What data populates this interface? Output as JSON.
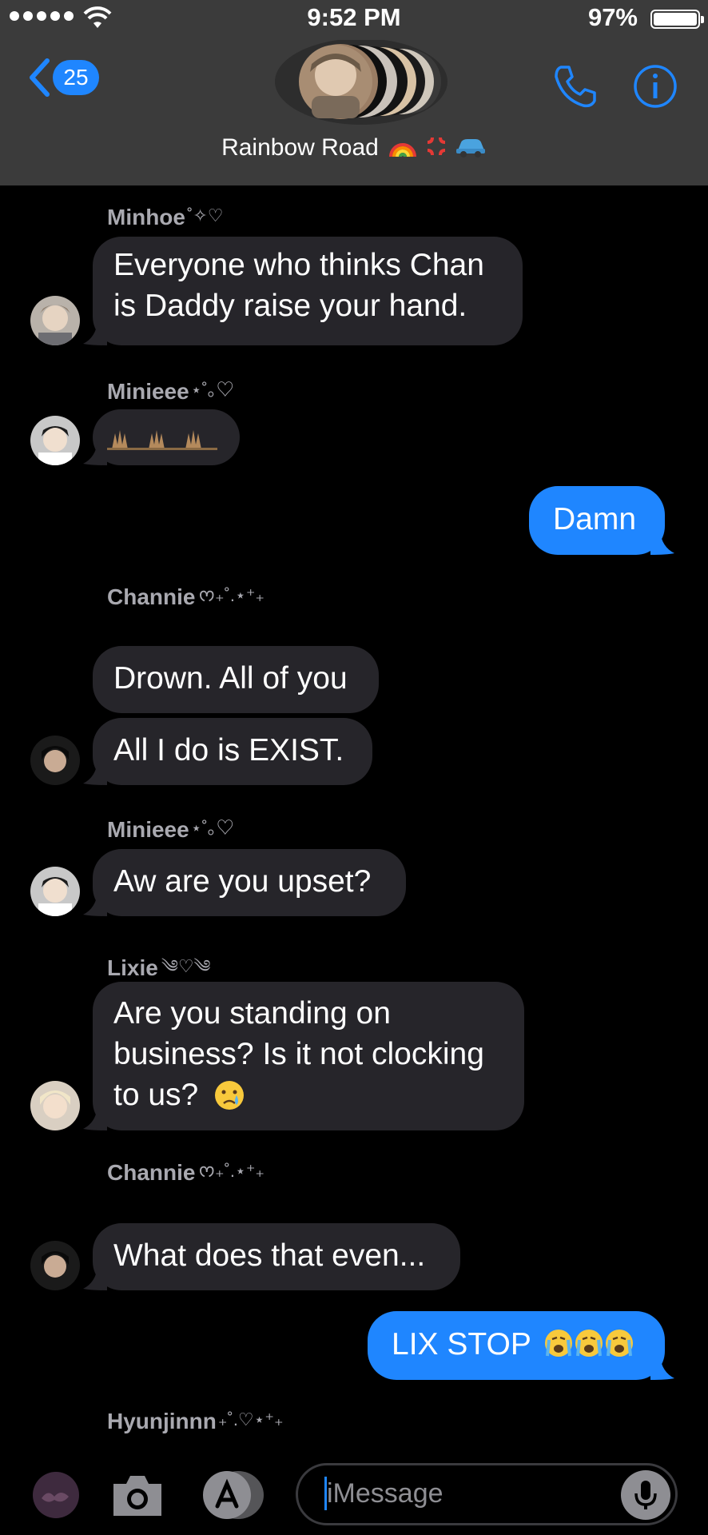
{
  "status_bar": {
    "time": "9:52 PM",
    "battery_percent": "97%",
    "battery_level": 0.97,
    "signal_bars": 5
  },
  "header": {
    "back_count": "25",
    "group_name": "Rainbow Road",
    "group_name_emojis": [
      "rainbow",
      "anger-symbol",
      "car"
    ],
    "icons": [
      "chevron-left-icon",
      "phone-icon",
      "info-icon"
    ]
  },
  "messages": [
    {
      "sender": "Minhoe",
      "sender_deco": "˚✧♡",
      "text": [
        "Everyone who thinks Chan",
        "is Daddy raise your hand."
      ],
      "direction": "in"
    },
    {
      "sender": "Minieee",
      "sender_deco": "⋆˚｡♡",
      "text": [],
      "content": "three raised-hands reaction",
      "direction": "in"
    },
    {
      "text": [
        "Damn"
      ],
      "direction": "out"
    },
    {
      "sender": "Channie",
      "sender_deco": "ᰔ₊˚.⋆⁺₊",
      "text": [
        "Drown. All of you"
      ],
      "direction": "in"
    },
    {
      "text": [
        "All I do is EXIST."
      ],
      "direction": "in"
    },
    {
      "sender": "Minieee",
      "sender_deco": "⋆˚｡♡",
      "text": [
        "Aw are you upset?"
      ],
      "direction": "in"
    },
    {
      "sender": "Lixie",
      "sender_deco": "༄♡༄",
      "text": [
        "Are you standing on",
        "business? Is it not clocking",
        "to us?"
      ],
      "emoji": "crying-face",
      "direction": "in"
    },
    {
      "sender": "Channie",
      "sender_deco": "ᰔ₊˚.⋆⁺₊",
      "text": [
        "What does that even..."
      ],
      "direction": "in"
    },
    {
      "text": [
        "LIX STOP"
      ],
      "emoji": "loudly-crying-face x3",
      "direction": "out"
    },
    {
      "sender": "Hyunjinnn",
      "sender_deco": "₊˚.♡⋆⁺₊",
      "text": [],
      "direction": "in"
    }
  ],
  "input": {
    "placeholder": "iMessage",
    "icons": [
      "digital-touch-icon",
      "camera-icon",
      "app-store-icon",
      "microphone-icon"
    ]
  },
  "colors": {
    "bar_bg": "#3b3b3b",
    "incoming_bubble": "#26252a",
    "outgoing_bubble": "#1f86ff",
    "accent": "#1f86ff",
    "sender_name": "#a9a9b0"
  }
}
